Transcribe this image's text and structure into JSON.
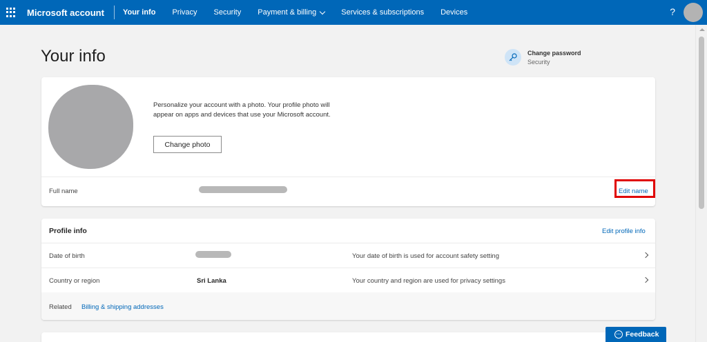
{
  "topbar": {
    "brand": "Microsoft account",
    "nav": [
      {
        "label": "Your info",
        "active": true
      },
      {
        "label": "Privacy"
      },
      {
        "label": "Security"
      },
      {
        "label": "Payment & billing",
        "has_dropdown": true
      },
      {
        "label": "Services & subscriptions"
      },
      {
        "label": "Devices"
      }
    ],
    "help": "?",
    "accent": "#0067b8"
  },
  "page": {
    "title": "Your info"
  },
  "change_password": {
    "title": "Change password",
    "subtitle": "Security",
    "icon": "key-icon"
  },
  "photo_card": {
    "description": "Personalize your account with a photo. Your profile photo will appear on apps and devices that use your Microsoft account.",
    "change_photo_label": "Change photo",
    "full_name_label": "Full name",
    "edit_name_label": "Edit name",
    "highlight_color": "#e00000"
  },
  "profile_info": {
    "heading": "Profile info",
    "edit_label": "Edit profile info",
    "rows": [
      {
        "label": "Date of birth",
        "value": "",
        "note": "Your date of birth is used for account safety setting"
      },
      {
        "label": "Country or region",
        "value": "Sri Lanka",
        "note": "Your country and region are used for privacy settings"
      }
    ],
    "related_label": "Related",
    "related_link": "Billing & shipping addresses"
  },
  "feedback": {
    "label": "Feedback",
    "icon": "feedback-icon"
  }
}
